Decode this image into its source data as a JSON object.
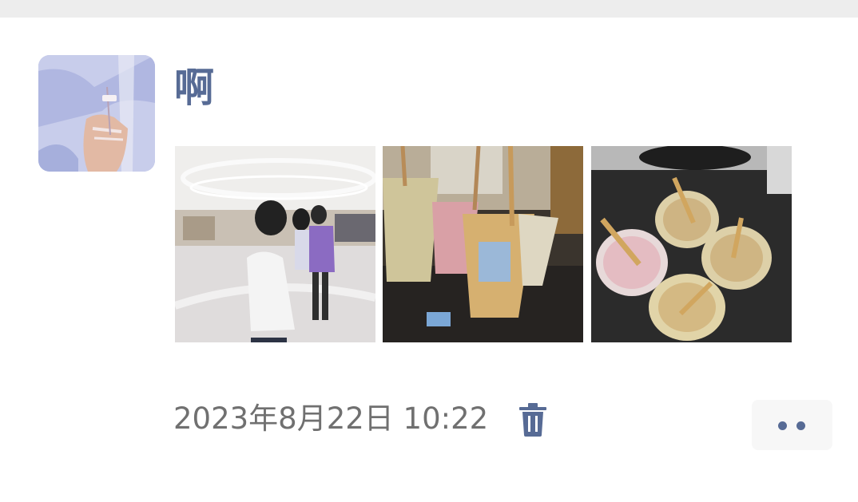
{
  "post": {
    "username": "啊",
    "timestamp": "2023年8月22日 10:22",
    "avatar_icon": "avatar-image",
    "photos": [
      {
        "name": "mall-photo",
        "description_icon": "photo-thumbnail"
      },
      {
        "name": "drinks-table-photo",
        "description_icon": "photo-thumbnail"
      },
      {
        "name": "drinks-topdown-photo",
        "description_icon": "photo-thumbnail"
      }
    ],
    "delete_icon": "trash-icon",
    "more_icon": "more-dots-icon"
  },
  "colors": {
    "link_blue": "#576b95",
    "timestamp_gray": "#707070",
    "top_strip": "#ededed",
    "more_button_bg": "#f7f7f7"
  }
}
